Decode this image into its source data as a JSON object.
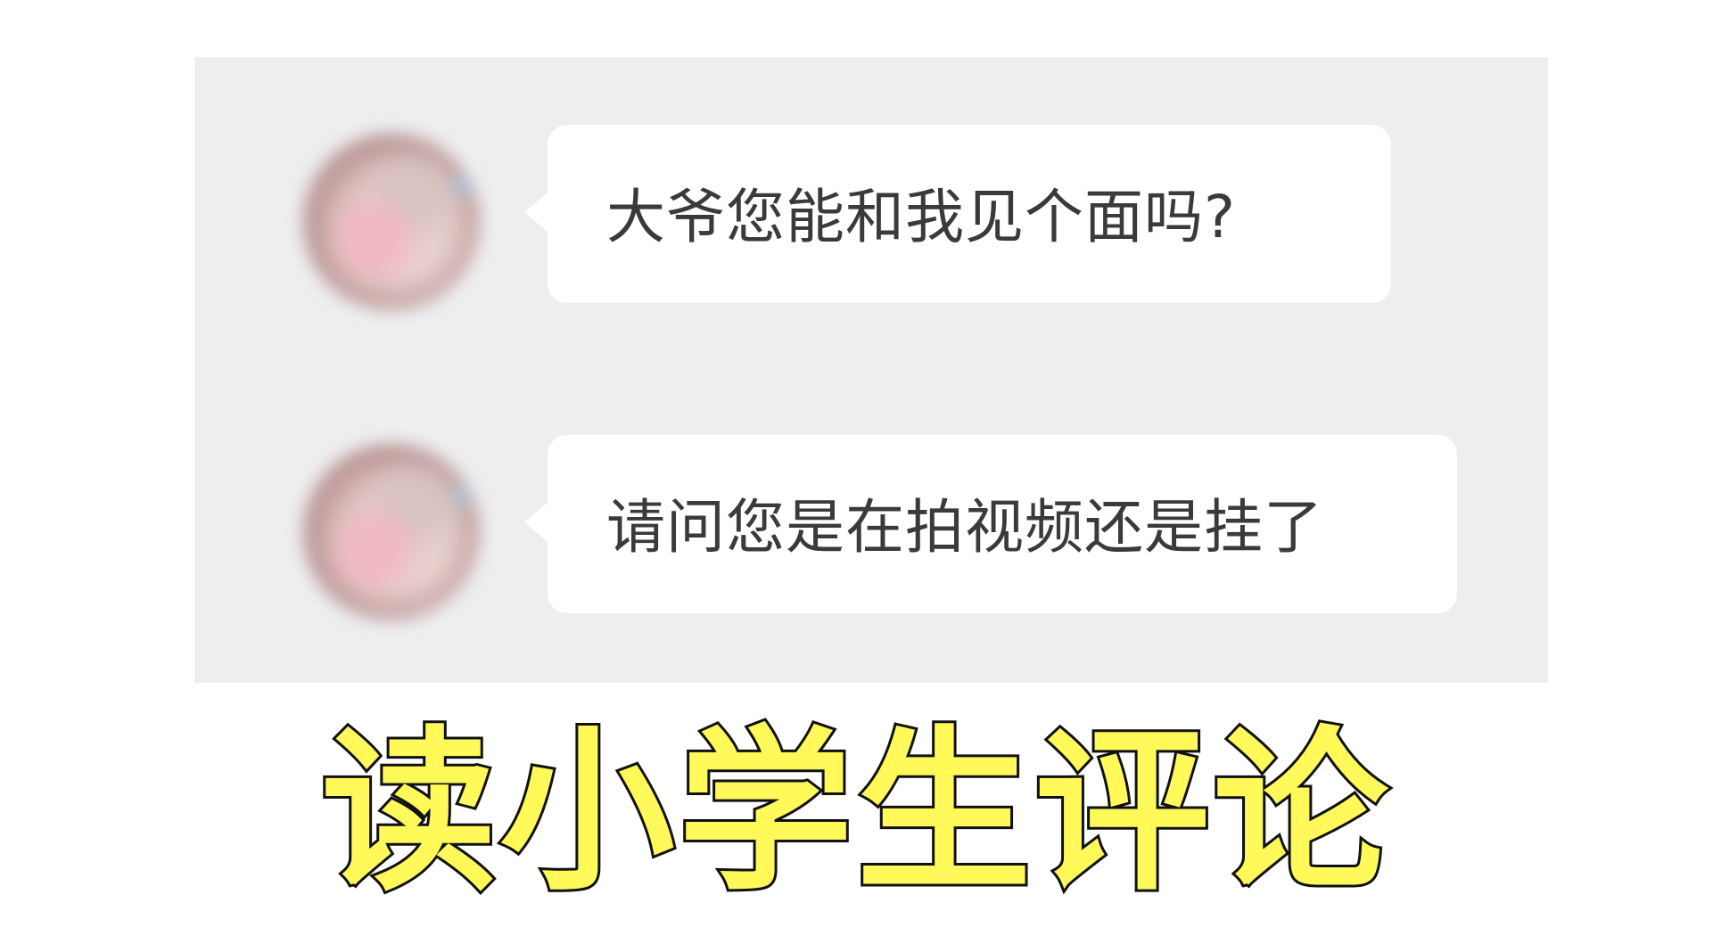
{
  "colors": {
    "panel_background": "#eeeef0",
    "bubble_background": "#ffffff",
    "message_text": "#3a3a3a",
    "headline_fill": "#fff95a",
    "headline_outline": "#111111"
  },
  "chat": {
    "messages": [
      {
        "avatar": "blurred-user-avatar",
        "text": "大爷您能和我见个面吗?"
      },
      {
        "avatar": "blurred-user-avatar",
        "text": "请问您是在拍视频还是挂了"
      }
    ]
  },
  "headline": {
    "text": "读小学生评论"
  }
}
